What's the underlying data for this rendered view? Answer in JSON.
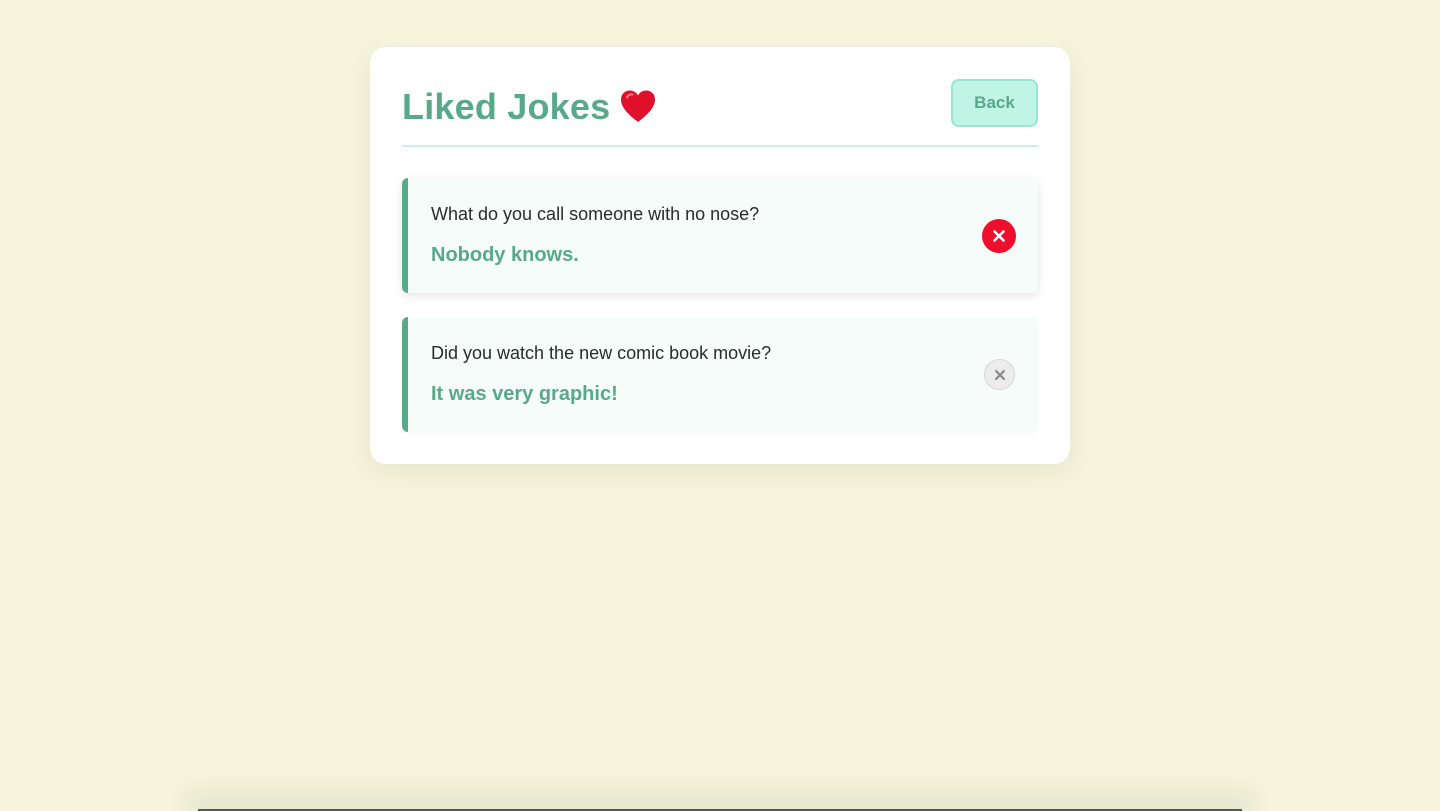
{
  "header": {
    "title": "Liked Jokes",
    "title_emoji_icon": "heart-icon",
    "back_label": "Back"
  },
  "jokes": [
    {
      "setup": "What do you call someone with no nose?",
      "punchline": "Nobody knows.",
      "remove_icon": "close-icon",
      "state": "active"
    },
    {
      "setup": "Did you watch the new comic book movie?",
      "punchline": "It was very graphic!",
      "remove_icon": "close-icon",
      "state": "muted"
    }
  ],
  "colors": {
    "background": "#f6f5dc",
    "accent": "#58a98b",
    "back_button_bg": "#c0f5e6",
    "remove_active": "#ee0f2c",
    "heart": "#e0102a"
  }
}
